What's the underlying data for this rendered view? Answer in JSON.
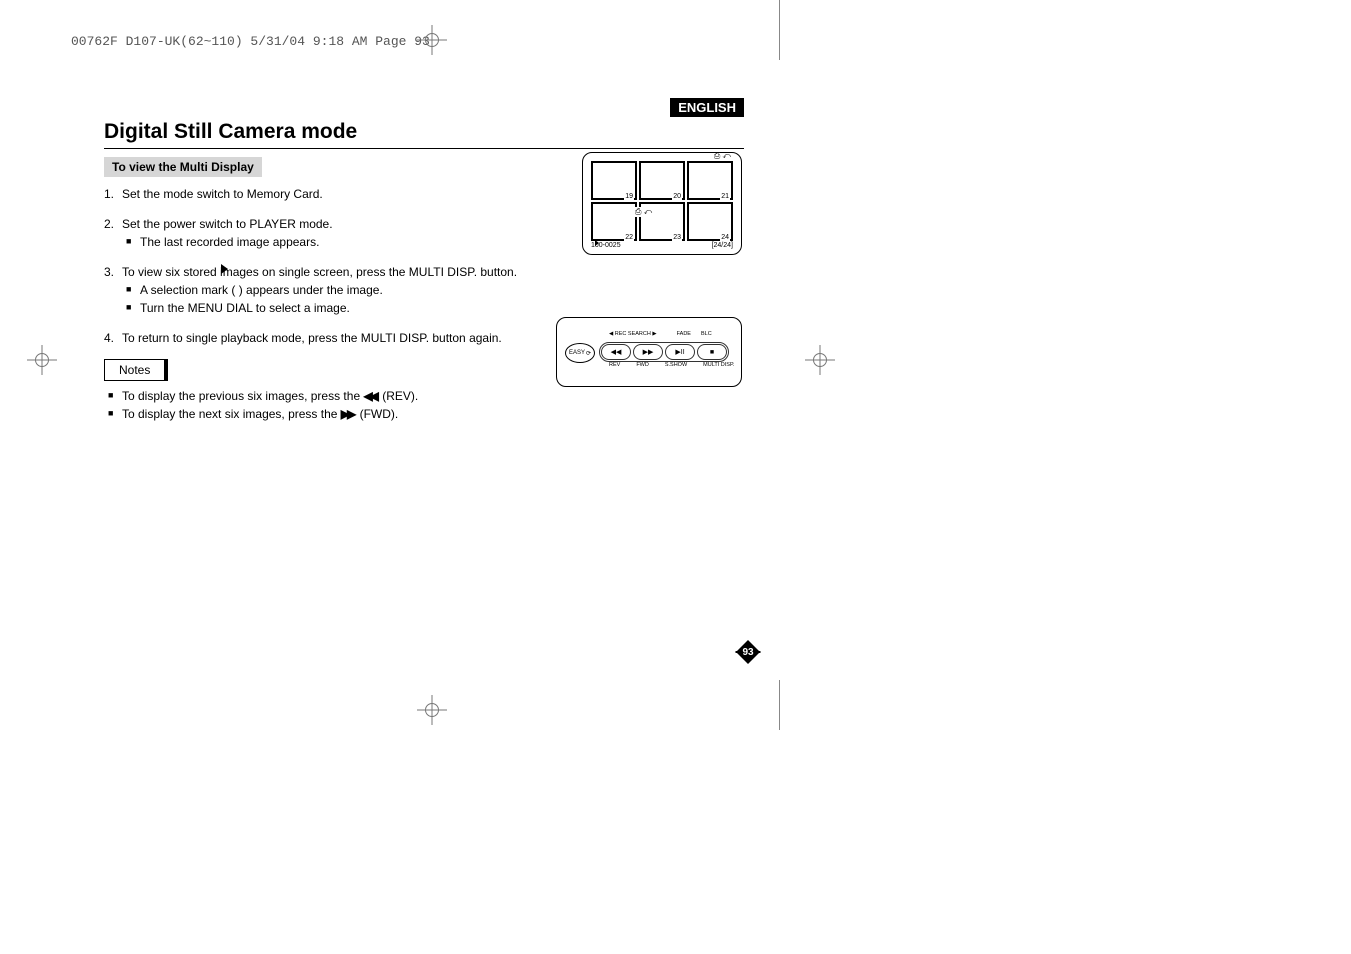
{
  "header": "00762F D107-UK(62~110)  5/31/04 9:18 AM  Page 93",
  "lang": "ENGLISH",
  "title": "Digital Still Camera mode",
  "subtitle": "To view the Multi Display",
  "steps": {
    "1": {
      "num": "1.",
      "text": "Set the mode switch to Memory Card."
    },
    "2": {
      "num": "2.",
      "text": "Set the power switch to PLAYER mode.",
      "sub": [
        "The last recorded image appears."
      ]
    },
    "3": {
      "num": "3.",
      "text": "To view six stored images on single screen, press the MULTI DISP. button.",
      "sub": [
        "A selection mark (      ) appears under the image.",
        "Turn the MENU DIAL to select a image."
      ]
    },
    "4": {
      "num": "4.",
      "text": "To return to single playback mode, press the MULTI DISP. button again."
    }
  },
  "notes": {
    "label": "Notes",
    "items": {
      "rev": {
        "pre": "To display the previous six images, press the ",
        "post": "(REV)."
      },
      "fwd": {
        "pre": "To display the next six images, press the ",
        "post": "(FWD)."
      }
    }
  },
  "lcd": {
    "thumbs": [
      "19",
      "20",
      "21",
      "22",
      "23",
      "24"
    ],
    "folder": "100-0025",
    "count": "[24/24]"
  },
  "panel": {
    "easy": "EASY",
    "top": [
      "REC SEARCH",
      "",
      "FADE",
      "BLC"
    ],
    "bot": [
      "REV",
      "FWD",
      "S.SHOW",
      "MULTI DISP."
    ],
    "btns": [
      "◀◀",
      "▶▶",
      "▶II",
      "■"
    ]
  },
  "pagenum": "93"
}
